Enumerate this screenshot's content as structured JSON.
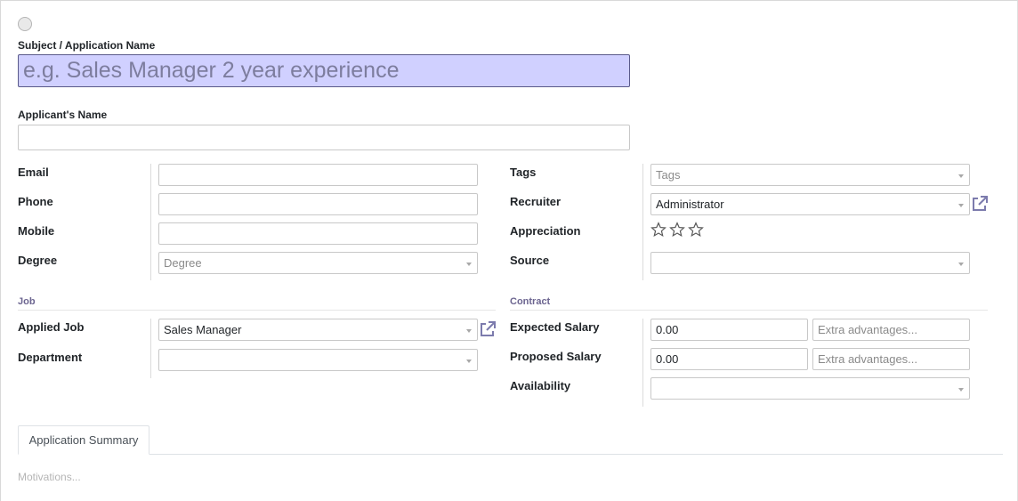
{
  "form": {
    "name_label": "Subject / Application Name",
    "name_placeholder": "e.g. Sales Manager 2 year experience",
    "applicant_label": "Applicant's Name",
    "applicant_value": ""
  },
  "left_fields": {
    "email_label": "Email",
    "email_value": "",
    "phone_label": "Phone",
    "phone_value": "",
    "mobile_label": "Mobile",
    "mobile_value": "",
    "degree_label": "Degree",
    "degree_placeholder": "Degree"
  },
  "right_fields": {
    "tags_label": "Tags",
    "tags_placeholder": "Tags",
    "recruiter_label": "Recruiter",
    "recruiter_value": "Administrator",
    "appreciation_label": "Appreciation",
    "appreciation_stars": 0,
    "appreciation_max": 3,
    "source_label": "Source",
    "source_value": ""
  },
  "job": {
    "title": "Job",
    "applied_job_label": "Applied Job",
    "applied_job_value": "Sales Manager",
    "department_label": "Department",
    "department_value": ""
  },
  "contract": {
    "title": "Contract",
    "expected_salary_label": "Expected Salary",
    "expected_salary_value": "0.00",
    "expected_extra_placeholder": "Extra advantages...",
    "proposed_salary_label": "Proposed Salary",
    "proposed_salary_value": "0.00",
    "proposed_extra_placeholder": "Extra advantages...",
    "availability_label": "Availability",
    "availability_value": ""
  },
  "tabs": {
    "summary_label": "Application Summary",
    "motivations_placeholder": "Motivations..."
  },
  "colors": {
    "name_input_bg": "#d0d0ff",
    "group_title": "#6c6590",
    "external_link": "#7c7bad"
  },
  "icons": {
    "priority": "circle-toggle",
    "external_link": "external-link-icon",
    "star": "star-outline-icon",
    "dropdown": "caret-down-icon"
  }
}
